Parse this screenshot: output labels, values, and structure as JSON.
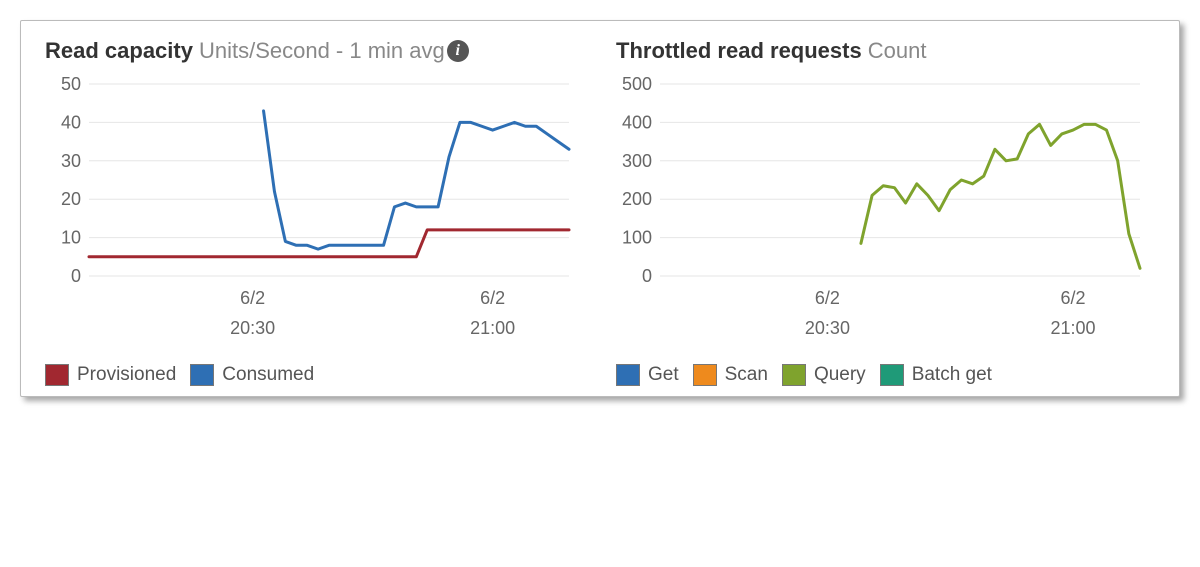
{
  "panels": {
    "left": {
      "title_strong": "Read capacity",
      "title_rest": "Units/Second - 1 min avg",
      "has_info_icon": true
    },
    "right": {
      "title_strong": "Throttled read requests",
      "title_rest": "Count",
      "has_info_icon": false
    }
  },
  "legends": {
    "left": [
      {
        "label": "Provisioned",
        "color": "#a12830"
      },
      {
        "label": "Consumed",
        "color": "#2e6fb4"
      }
    ],
    "right": [
      {
        "label": "Get",
        "color": "#2e6fb4"
      },
      {
        "label": "Scan",
        "color": "#ee8a1d"
      },
      {
        "label": "Query",
        "color": "#7fa32d"
      },
      {
        "label": "Batch get",
        "color": "#1f9a78"
      }
    ]
  },
  "chart_data": [
    {
      "type": "line",
      "title": "Read capacity",
      "subtitle": "Units/Second - 1 min avg",
      "xlabel": "",
      "ylabel": "",
      "ylim": [
        0,
        50
      ],
      "y_ticks": [
        0,
        10,
        20,
        30,
        40,
        50
      ],
      "x_tick_labels": [
        {
          "top": "6/2",
          "bottom": "20:30"
        },
        {
          "top": "6/2",
          "bottom": "21:00"
        }
      ],
      "x": [
        0,
        1,
        2,
        3,
        4,
        5,
        6,
        7,
        8,
        9,
        10,
        11,
        12,
        13,
        14,
        15,
        16,
        17,
        18,
        19,
        20,
        21,
        22,
        23,
        24,
        25,
        26,
        27,
        28,
        29,
        30,
        31,
        32,
        33,
        34,
        35,
        36,
        37,
        38,
        39,
        40,
        41,
        42,
        43,
        44
      ],
      "series": [
        {
          "name": "Provisioned",
          "color": "#a12830",
          "values": [
            5,
            5,
            5,
            5,
            5,
            5,
            5,
            5,
            5,
            5,
            5,
            5,
            5,
            5,
            5,
            5,
            5,
            5,
            5,
            5,
            5,
            5,
            5,
            5,
            5,
            5,
            5,
            5,
            5,
            5,
            5,
            12,
            12,
            12,
            12,
            12,
            12,
            12,
            12,
            12,
            12,
            12,
            12,
            12,
            12
          ]
        },
        {
          "name": "Consumed",
          "color": "#2e6fb4",
          "values": [
            null,
            null,
            null,
            null,
            null,
            null,
            null,
            null,
            null,
            null,
            null,
            null,
            null,
            null,
            null,
            null,
            43,
            22,
            9,
            8,
            8,
            7,
            8,
            8,
            8,
            8,
            8,
            8,
            18,
            19,
            18,
            18,
            18,
            31,
            40,
            40,
            39,
            38,
            39,
            40,
            39,
            39,
            37,
            35,
            33
          ]
        }
      ],
      "x_tick_positions": [
        15,
        37
      ]
    },
    {
      "type": "line",
      "title": "Throttled read requests",
      "subtitle": "Count",
      "xlabel": "",
      "ylabel": "",
      "ylim": [
        0,
        500
      ],
      "y_ticks": [
        0,
        100,
        200,
        300,
        400,
        500
      ],
      "x_tick_labels": [
        {
          "top": "6/2",
          "bottom": "20:30"
        },
        {
          "top": "6/2",
          "bottom": "21:00"
        }
      ],
      "x": [
        0,
        1,
        2,
        3,
        4,
        5,
        6,
        7,
        8,
        9,
        10,
        11,
        12,
        13,
        14,
        15,
        16,
        17,
        18,
        19,
        20,
        21,
        22,
        23,
        24,
        25,
        26,
        27,
        28,
        29,
        30,
        31,
        32,
        33,
        34,
        35,
        36,
        37,
        38,
        39,
        40,
        41,
        42,
        43
      ],
      "series": [
        {
          "name": "Query",
          "color": "#7fa32d",
          "values": [
            null,
            null,
            null,
            null,
            null,
            null,
            null,
            null,
            null,
            null,
            null,
            null,
            null,
            null,
            null,
            null,
            null,
            null,
            85,
            210,
            235,
            230,
            190,
            240,
            210,
            170,
            225,
            250,
            240,
            260,
            330,
            300,
            305,
            370,
            395,
            340,
            370,
            380,
            395,
            395,
            380,
            300,
            110,
            20
          ]
        }
      ],
      "x_tick_positions": [
        15,
        37
      ]
    }
  ]
}
